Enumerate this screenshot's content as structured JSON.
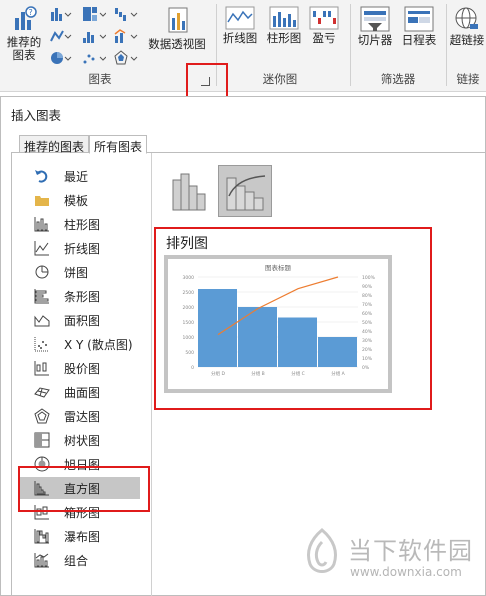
{
  "ribbon": {
    "recommended_charts": "推荐的\n图表",
    "pivot_chart": "数据透视图",
    "line": "折线图",
    "column": "柱形图",
    "win_loss": "盈亏",
    "slicer": "切片器",
    "timeline": "日程表",
    "hyperlink": "超链接",
    "groups": {
      "charts": "图表",
      "sparklines": "迷你图",
      "filters": "筛选器",
      "links": "链接"
    }
  },
  "dialog": {
    "title": "插入图表",
    "tabs": [
      "推荐的图表",
      "所有图表"
    ],
    "sidebar_items": [
      "最近",
      "模板",
      "柱形图",
      "折线图",
      "饼图",
      "条形图",
      "面积图",
      "X Y (散点图)",
      "股价图",
      "曲面图",
      "雷达图",
      "树状图",
      "旭日图",
      "直方图",
      "箱形图",
      "瀑布图",
      "组合"
    ],
    "selected_item": "直方图",
    "chart_name": "排列图",
    "preview": {
      "title": "图表标题",
      "left_ticks": [
        "3000",
        "2500",
        "2000",
        "1500",
        "1000",
        "500",
        "0"
      ],
      "right_ticks": [
        "100%",
        "90%",
        "80%",
        "70%",
        "60%",
        "50%",
        "40%",
        "30%",
        "20%",
        "10%",
        "0%"
      ],
      "categories": [
        "分组 D",
        "分组 B",
        "分组 C",
        "分组 A"
      ],
      "values": [
        2600,
        2000,
        1650,
        1000
      ],
      "max": 3000,
      "cumulative": [
        0.36,
        0.65,
        0.87,
        1.0
      ],
      "bar_color": "#5b9bd5",
      "line_color": "#ed7d31"
    }
  },
  "watermark": {
    "name": "当下软件园",
    "url": "www.downxia.com"
  },
  "colors": {
    "highlight": "#e01b1b"
  }
}
